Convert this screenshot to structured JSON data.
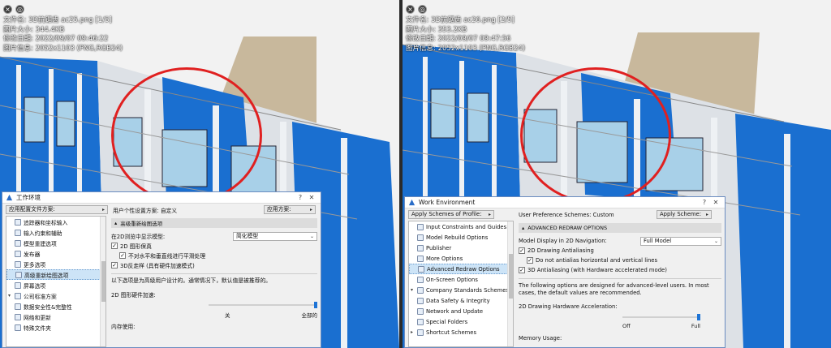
{
  "left": {
    "file_info": [
      "文件名: 3D抗锯齿 ac25.png [1/5]",
      "图片大小: 344.4KB",
      "修改日期: 2022/09/07 09:46:22",
      "图片信息: 2052x1103 (PNG,RGB24)"
    ],
    "dialog": {
      "title": "工作环境",
      "help": "?",
      "close": "✕",
      "apply_scheme": "应用配置文件方案:",
      "user_pref": "用户个性设置方案: 自定义",
      "apply_btn": "应用方案:",
      "tree": [
        {
          "label": "追踪器和坐标输入",
          "sel": false,
          "exp": ""
        },
        {
          "label": "输入约束和辅助",
          "sel": false,
          "exp": ""
        },
        {
          "label": "模型重建选项",
          "sel": false,
          "exp": ""
        },
        {
          "label": "发布器",
          "sel": false,
          "exp": ""
        },
        {
          "label": "更多选项",
          "sel": false,
          "exp": ""
        },
        {
          "label": "高级重新绘图选项",
          "sel": true,
          "exp": ""
        },
        {
          "label": "屏幕选项",
          "sel": false,
          "exp": ""
        },
        {
          "label": "公司标准方案",
          "sel": false,
          "exp": "▾"
        },
        {
          "label": "数据安全性&完整性",
          "sel": false,
          "exp": ""
        },
        {
          "label": "网络和更新",
          "sel": false,
          "exp": ""
        },
        {
          "label": "特殊文件夹",
          "sel": false,
          "exp": ""
        }
      ],
      "section": "高级重新绘图选项",
      "display_label": "在2D浏览中显示模型:",
      "display_value": "简化模型",
      "cb1": "2D 图形保真",
      "cb2": "不对水平和垂直线进行平滑处理",
      "cb3": "3D反走样 (具有硬件加速模式)",
      "desc": "以下选项是为高级用户设计的。通常情况下，默认值是被推荐的。",
      "accel_label": "2D 图形硬件加速:",
      "off": "关",
      "full": "全部的",
      "memory": "内存使用:"
    }
  },
  "right": {
    "file_info": [
      "文件名: 3D抗锯齿 ac26.png [2/5]",
      "图片大小: 353.2KB",
      "修改日期: 2022/09/07 09:47:56",
      "图片信息: 2052x1103 (PNG,RGB24)"
    ],
    "dialog": {
      "title": "Work Environment",
      "help": "?",
      "close": "✕",
      "apply_scheme": "Apply Schemes of Profile:",
      "user_pref": "User Preference Schemes: Custom",
      "apply_btn": "Apply Scheme:",
      "tree": [
        {
          "label": "Input Constraints and Guides",
          "sel": false,
          "exp": ""
        },
        {
          "label": "Model Rebuild Options",
          "sel": false,
          "exp": ""
        },
        {
          "label": "Publisher",
          "sel": false,
          "exp": ""
        },
        {
          "label": "More Options",
          "sel": false,
          "exp": ""
        },
        {
          "label": "Advanced Redraw Options",
          "sel": true,
          "exp": ""
        },
        {
          "label": "On-Screen Options",
          "sel": false,
          "exp": ""
        },
        {
          "label": "Company Standards Schemes",
          "sel": false,
          "exp": "▾"
        },
        {
          "label": "Data Safety & Integrity",
          "sel": false,
          "exp": ""
        },
        {
          "label": "Network and Update",
          "sel": false,
          "exp": ""
        },
        {
          "label": "Special Folders",
          "sel": false,
          "exp": ""
        },
        {
          "label": "Shortcut Schemes",
          "sel": false,
          "exp": "▸"
        }
      ],
      "section": "ADVANCED REDRAW OPTIONS",
      "display_label": "Model Display in 2D Navigation:",
      "display_value": "Full Model",
      "cb1": "2D Drawing Antialiasing",
      "cb2": "Do not antialias horizontal and vertical lines",
      "cb3": "3D Antialiasing (with Hardware accelerated mode)",
      "desc": "The following options are designed for advanced-level users. In most cases, the default values are recommended.",
      "accel_label": "2D Drawing Hardware Acceleration:",
      "off": "Off",
      "full": "Full",
      "memory": "Memory Usage:"
    }
  },
  "colors": {
    "facade_blue": "#1a6fd0",
    "circle_red": "#e02020",
    "roof_tan": "#c8b89c"
  }
}
